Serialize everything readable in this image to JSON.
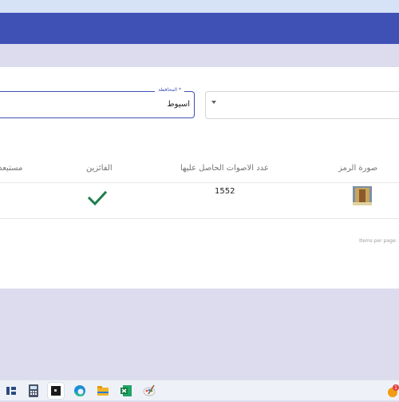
{
  "filters": {
    "governorate_label": "المحافظة *",
    "governorate_value": "اسيوط",
    "second_select_value": ""
  },
  "table": {
    "headers": [
      "صورة الرمز",
      "عدد الاصوات الحاصل عليها",
      "الفائزين",
      "مستبعد"
    ],
    "rows": [
      {
        "symbol_image": "building-photo",
        "votes": "1552",
        "winner": "check-icon",
        "excluded": ""
      }
    ]
  },
  "paginator": {
    "items_per_page_label": "Items per page:"
  },
  "taskbar": {
    "icons": [
      "widgets-icon",
      "calculator-icon",
      "terminal-icon",
      "edge-browser-icon",
      "file-explorer-icon",
      "excel-icon",
      "paint-icon",
      "user-avatar-icon"
    ],
    "badge": "1"
  },
  "colors": {
    "primary": "#3f51b5",
    "success": "#1e7d4f",
    "page_bg": "#dcdcee"
  }
}
